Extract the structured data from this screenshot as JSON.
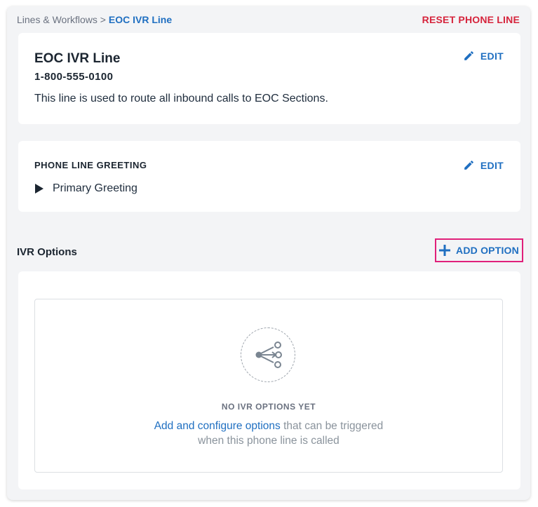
{
  "breadcrumb": {
    "parent": "Lines & Workflows",
    "separator": ">",
    "current": "EOC IVR Line"
  },
  "header": {
    "reset_label": "RESET PHONE LINE"
  },
  "line_card": {
    "title": "EOC IVR Line",
    "number": "1-800-555-0100",
    "description": "This line is used to route all inbound calls to EOC Sections.",
    "edit_label": "EDIT"
  },
  "greeting_card": {
    "title": "PHONE LINE GREETING",
    "greeting_name": "Primary Greeting",
    "edit_label": "EDIT"
  },
  "ivr": {
    "heading": "IVR Options",
    "add_label": "ADD OPTION",
    "empty_title": "NO IVR OPTIONS YET",
    "empty_link": "Add and configure options",
    "empty_text_1": "that can be triggered",
    "empty_text_2": "when this phone line is called"
  },
  "colors": {
    "accent": "#1f6fc1",
    "danger": "#d6243c",
    "highlight": "#e0207a"
  },
  "icons": [
    "pencil-icon",
    "play-icon",
    "plus-icon",
    "branch-icon"
  ]
}
